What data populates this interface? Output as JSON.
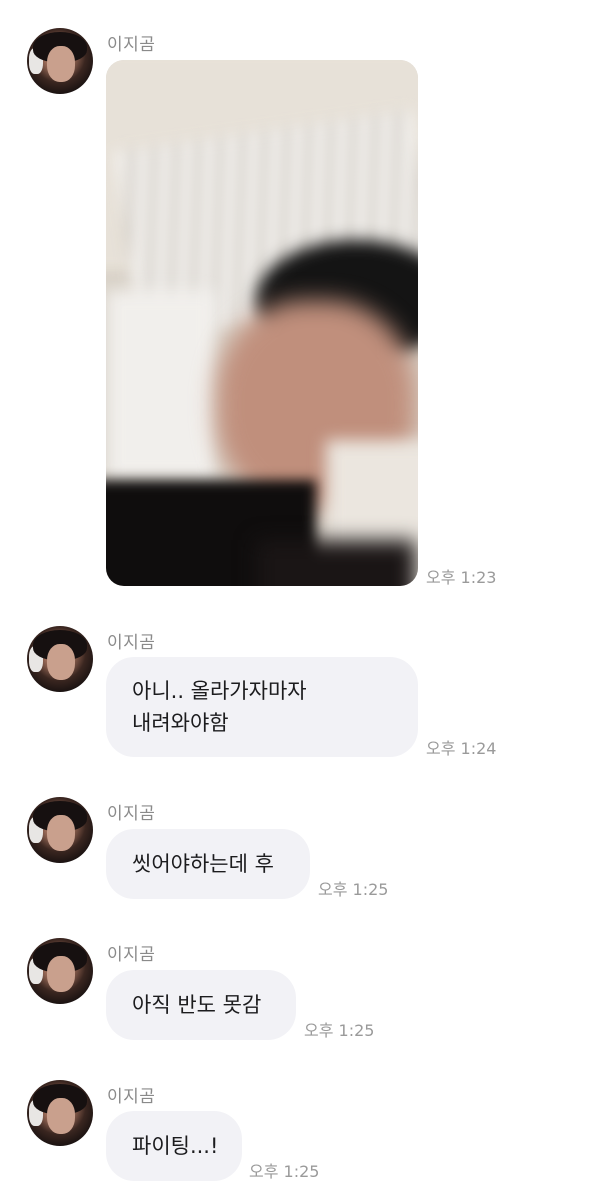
{
  "sender_name": "이지곰",
  "messages": [
    {
      "type": "photo",
      "time": "오후 1:23"
    },
    {
      "type": "text",
      "lines": [
        "아니.. 올라가자마자",
        "내려와야함"
      ],
      "time": "오후 1:24"
    },
    {
      "type": "text",
      "lines": [
        "씻어야하는데 후"
      ],
      "time": "오후 1:25"
    },
    {
      "type": "text",
      "lines": [
        "아직 반도 못감"
      ],
      "time": "오후 1:25"
    },
    {
      "type": "text",
      "lines": [
        "파이팅...!"
      ],
      "time": "오후 1:25"
    }
  ]
}
